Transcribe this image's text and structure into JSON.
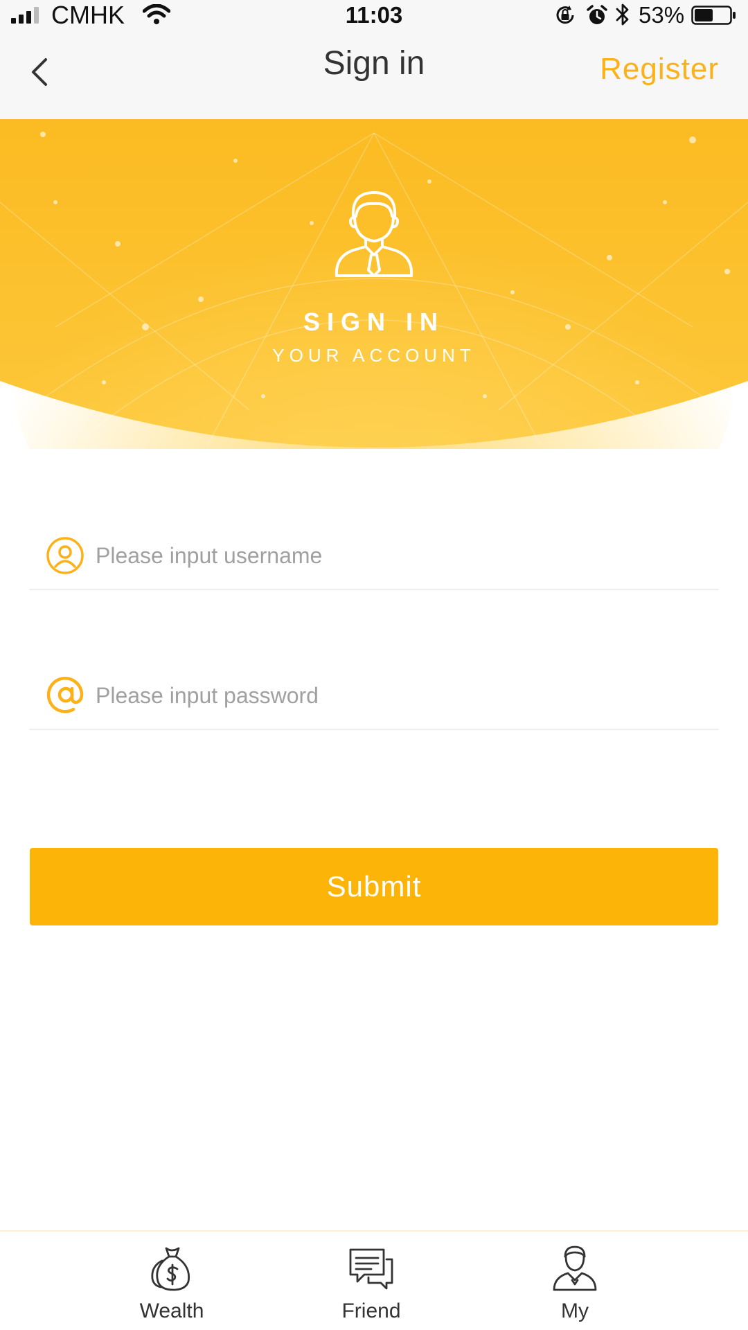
{
  "status_bar": {
    "carrier": "CMHK",
    "time": "11:03",
    "battery_percent": "53%",
    "battery_level": 0.53,
    "icons": [
      "signal-icon",
      "wifi-icon",
      "rotation-lock-icon",
      "alarm-icon",
      "bluetooth-icon",
      "battery-icon"
    ]
  },
  "nav": {
    "back_icon": "chevron-left-icon",
    "title": "Sign in",
    "register_label": "Register"
  },
  "hero": {
    "icon": "businessman-avatar-icon",
    "title": "SIGN IN",
    "subtitle": "YOUR ACCOUNT",
    "color": "#fcc12b"
  },
  "form": {
    "username": {
      "icon": "user-circle-icon",
      "placeholder": "Please input username",
      "value": ""
    },
    "password": {
      "icon": "at-sign-icon",
      "placeholder": "Please input password",
      "value": ""
    },
    "submit_label": "Submit"
  },
  "tabs": [
    {
      "icon": "money-bag-icon",
      "label": "Wealth"
    },
    {
      "icon": "chat-bubbles-icon",
      "label": "Friend"
    },
    {
      "icon": "person-icon",
      "label": "My"
    }
  ],
  "colors": {
    "accent": "#fbb117",
    "button": "#fdb408",
    "divider": "#eeeeee"
  }
}
